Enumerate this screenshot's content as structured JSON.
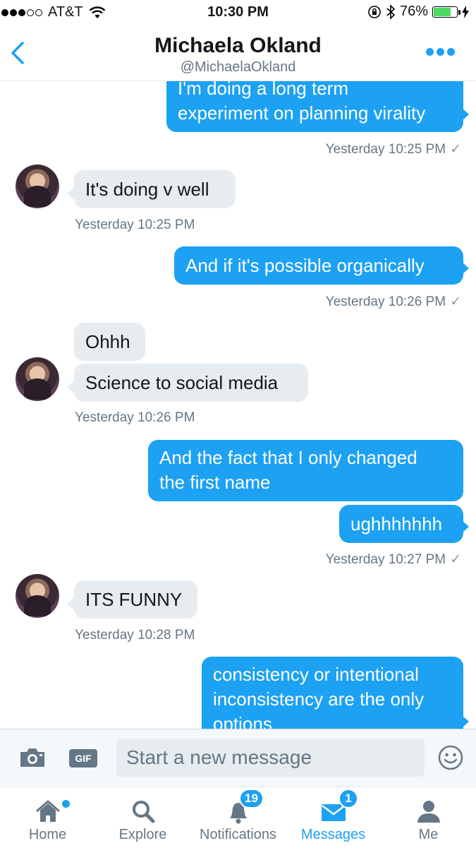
{
  "status_bar": {
    "carrier": "AT&T",
    "time": "10:30 PM",
    "battery_percent": "76%",
    "battery_level": 0.76,
    "signal_bars": 3,
    "signal_total": 5
  },
  "header": {
    "name": "Michaela Okland",
    "handle": "@MichaelaOkland"
  },
  "messages": [
    {
      "dir": "out",
      "lines": [
        "I'm doing a long term",
        "experiment on planning virality"
      ],
      "timestamp": "Yesterday 10:25 PM"
    },
    {
      "dir": "in",
      "lines": [
        "It's doing v well"
      ],
      "timestamp": "Yesterday 10:25 PM"
    },
    {
      "dir": "out",
      "lines": [
        "And if it's possible organically"
      ],
      "timestamp": "Yesterday 10:26 PM"
    },
    {
      "dir": "in",
      "lines": [
        "Ohhh"
      ],
      "timestamp": null
    },
    {
      "dir": "in",
      "lines": [
        "Science to social media"
      ],
      "timestamp": "Yesterday 10:26 PM"
    },
    {
      "dir": "out",
      "lines": [
        "And the fact that I only changed",
        "the first name"
      ],
      "timestamp": null
    },
    {
      "dir": "out",
      "lines": [
        "ughhhhhhh"
      ],
      "timestamp": "Yesterday 10:27 PM"
    },
    {
      "dir": "in",
      "lines": [
        "ITS FUNNY"
      ],
      "timestamp": "Yesterday 10:28 PM"
    },
    {
      "dir": "out",
      "lines": [
        "consistency or intentional",
        "inconsistency are the only",
        "options"
      ],
      "timestamp": null
    }
  ],
  "read_check": "✓",
  "composer": {
    "placeholder": "Start a new message",
    "gif_label": "GIF"
  },
  "tabs": [
    {
      "label": "Home",
      "icon": "home-icon",
      "badge": null,
      "dot": true,
      "active": false
    },
    {
      "label": "Explore",
      "icon": "search-icon",
      "badge": null,
      "dot": false,
      "active": false
    },
    {
      "label": "Notifications",
      "icon": "bell-icon",
      "badge": "19",
      "dot": false,
      "active": false
    },
    {
      "label": "Messages",
      "icon": "envelope-icon",
      "badge": "1",
      "dot": false,
      "active": true
    },
    {
      "label": "Me",
      "icon": "person-icon",
      "badge": null,
      "dot": false,
      "active": false
    }
  ],
  "colors": {
    "accent": "#1da1f2",
    "incoming_bubble": "#e6ecf0",
    "secondary_text": "#657786",
    "battery_green": "#4cd964"
  }
}
